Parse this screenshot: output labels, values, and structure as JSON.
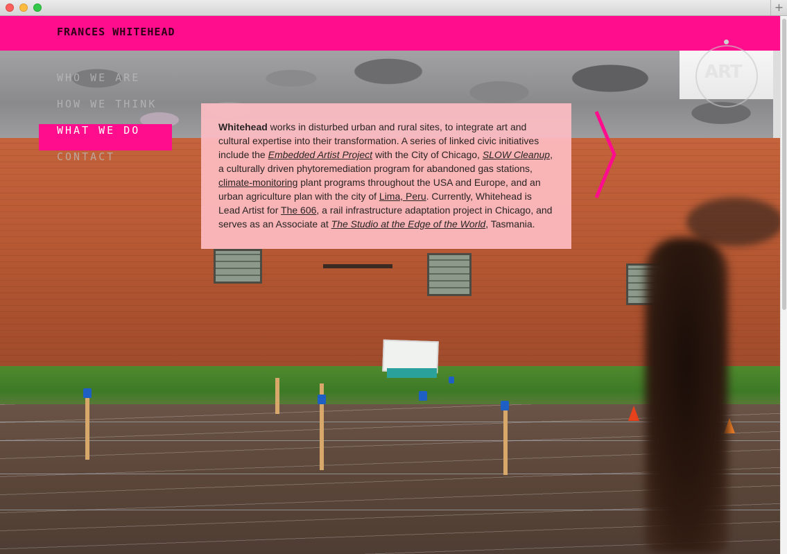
{
  "window": {
    "new_tab_glyph": "+"
  },
  "header": {
    "site_title": "FRANCES WHITEHEAD"
  },
  "nav": {
    "items": [
      {
        "label": "WHO WE ARE"
      },
      {
        "label": "HOW WE THINK"
      },
      {
        "label": "WHAT WE DO"
      },
      {
        "label": "CONTACT"
      }
    ],
    "active": "WHAT WE DO"
  },
  "logo": {
    "text": "ART"
  },
  "panel": {
    "name": "Whitehead",
    "t1": " works in disturbed urban and rural sites, to integrate art and cultural expertise into their transformation. A series of linked civic initiatives include the ",
    "link_embedded": "Embedded Artist Project",
    "t2": " with the City of Chicago, ",
    "link_slow": "SLOW Cleanup",
    "t3": ", a culturally driven phytoremediation program for abandoned gas stations, ",
    "link_climate": "climate-monitoring",
    "t4": " plant programs throughout the USA and Europe, and an urban agriculture plan with the city of ",
    "link_lima": "Lima, Peru",
    "t5": ". Currently, Whitehead is Lead Artist for ",
    "link_606": "The 606",
    "t6": ", a rail infrastructure adaptation project in Chicago, and serves as an Associate at ",
    "link_studio": "The Studio at the Edge of the World",
    "t7": ", Tasmania."
  },
  "colors": {
    "brand_pink": "#ff0d8c",
    "panel_pink": "#ffbec4",
    "title_dark": "#2b0016"
  }
}
